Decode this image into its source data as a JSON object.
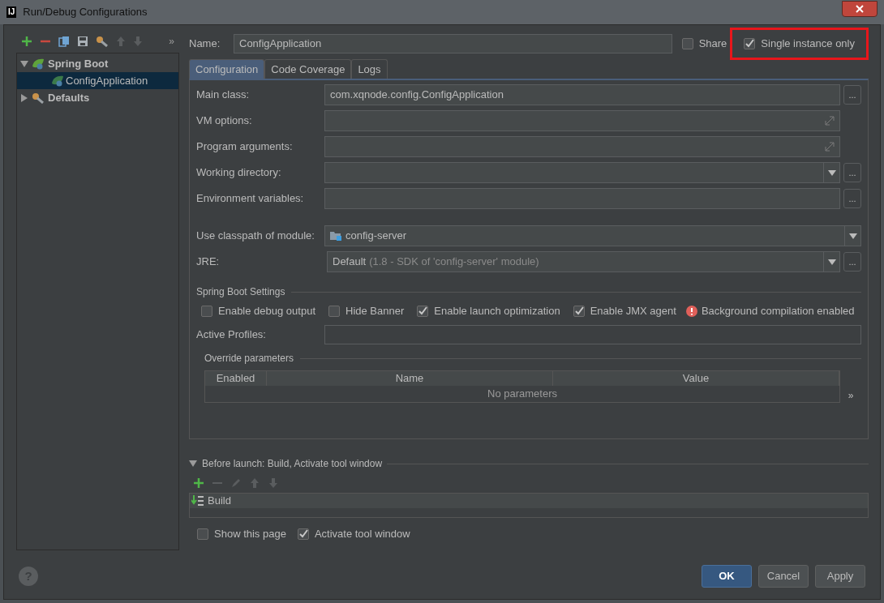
{
  "window": {
    "title": "Run/Debug Configurations",
    "app_badge": "IJ"
  },
  "left_toolbar": {
    "more": "»"
  },
  "tree": [
    {
      "label": "Spring Boot",
      "kind": "spring",
      "expanded": true,
      "selected": false,
      "children": [
        {
          "label": "ConfigApplication",
          "kind": "app",
          "selected": true
        }
      ]
    },
    {
      "label": "Defaults",
      "kind": "defaults",
      "expanded": false,
      "selected": false
    }
  ],
  "name_field": {
    "label": "Name:",
    "value": "ConfigApplication"
  },
  "share": {
    "label": "Share",
    "checked": false
  },
  "single_instance": {
    "label": "Single instance only",
    "checked": true,
    "highlighted": true
  },
  "tabs": [
    {
      "label": "Configuration",
      "selected": true
    },
    {
      "label": "Code Coverage",
      "selected": false
    },
    {
      "label": "Logs",
      "selected": false
    }
  ],
  "fields": [
    {
      "label": "Main class:",
      "kind": "browse",
      "value": "com.xqnode.config.ConfigApplication",
      "button": "..."
    },
    {
      "label": "VM options:",
      "kind": "expand"
    },
    {
      "label": "Program arguments:",
      "kind": "expand"
    },
    {
      "label": "Working directory:",
      "kind": "combo_browse",
      "button": "..."
    },
    {
      "label": "Environment variables:",
      "kind": "browse",
      "button": "..."
    },
    {
      "label": "Use classpath of module:",
      "kind": "module",
      "value": "config-server"
    },
    {
      "label": "JRE:",
      "kind": "jre",
      "value": "Default",
      "hint": "(1.8 - SDK of 'config-server' module)",
      "button": "..."
    }
  ],
  "spring_boot_settings": {
    "title": "Spring Boot Settings",
    "options": [
      {
        "label": "Enable debug output",
        "checked": false
      },
      {
        "label": "Hide Banner",
        "checked": false
      },
      {
        "label": "Enable launch optimization",
        "checked": true
      },
      {
        "label": "Enable JMX agent",
        "checked": true
      }
    ],
    "warning": "Background compilation enabled",
    "active_profiles": {
      "label": "Active Profiles:"
    }
  },
  "override_parameters": {
    "title": "Override parameters",
    "columns": [
      "Enabled",
      "Name",
      "Value"
    ],
    "empty_text": "No parameters",
    "more": "»"
  },
  "before_launch": {
    "title": "Before launch: Build, Activate tool window",
    "expanded": true,
    "items": [
      {
        "label": "Build"
      }
    ]
  },
  "show_this_page": {
    "label": "Show this page",
    "checked": false
  },
  "activate_tool_window": {
    "label": "Activate tool window",
    "checked": true
  },
  "help": "?",
  "buttons": [
    {
      "label": "OK",
      "default": true
    },
    {
      "label": "Cancel",
      "default": false
    },
    {
      "label": "Apply",
      "default": false
    }
  ]
}
